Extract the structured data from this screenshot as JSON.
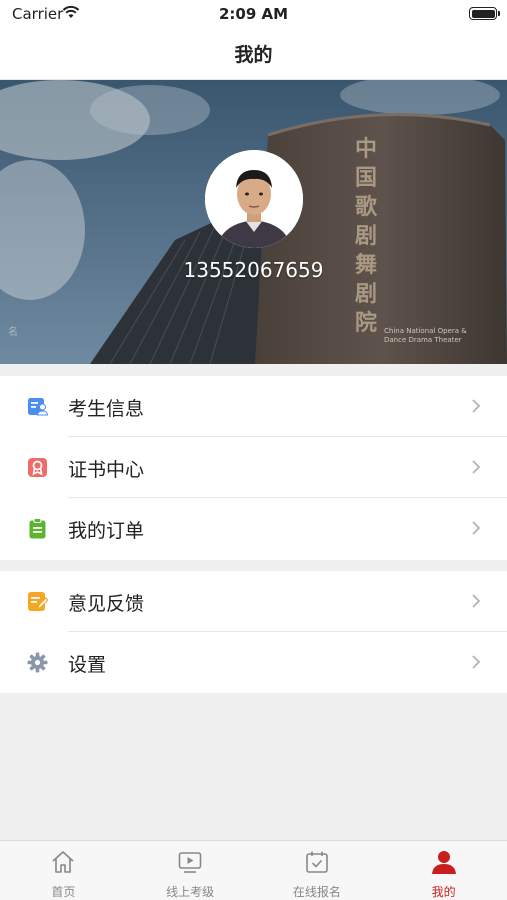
{
  "status_bar": {
    "carrier": "Carrier",
    "time": "2:09 AM"
  },
  "nav": {
    "title": "我的"
  },
  "profile": {
    "phone": "13552067659",
    "building_sign": "中国歌剧舞剧院",
    "building_sign_en_line1": "China National Opera &",
    "building_sign_en_line2": "Dance Drama Theater"
  },
  "menu_groups": [
    [
      {
        "label": "考生信息",
        "icon": "student-info-icon",
        "color": "#4a8ef0"
      },
      {
        "label": "证书中心",
        "icon": "certificate-icon",
        "color": "#f06a6a"
      },
      {
        "label": "我的订单",
        "icon": "order-icon",
        "color": "#5bb32e"
      }
    ],
    [
      {
        "label": "意见反馈",
        "icon": "feedback-icon",
        "color": "#f5a623"
      },
      {
        "label": "设置",
        "icon": "gear-icon",
        "color": "#8a97ab"
      }
    ]
  ],
  "tabs": [
    {
      "label": "首页",
      "icon": "home-icon",
      "active": false
    },
    {
      "label": "线上考级",
      "icon": "video-play-icon",
      "active": false
    },
    {
      "label": "在线报名",
      "icon": "calendar-check-icon",
      "active": false
    },
    {
      "label": "我的",
      "icon": "user-icon",
      "active": true
    }
  ],
  "colors": {
    "accent": "#c81e1e",
    "inactive_tab": "#888888"
  }
}
